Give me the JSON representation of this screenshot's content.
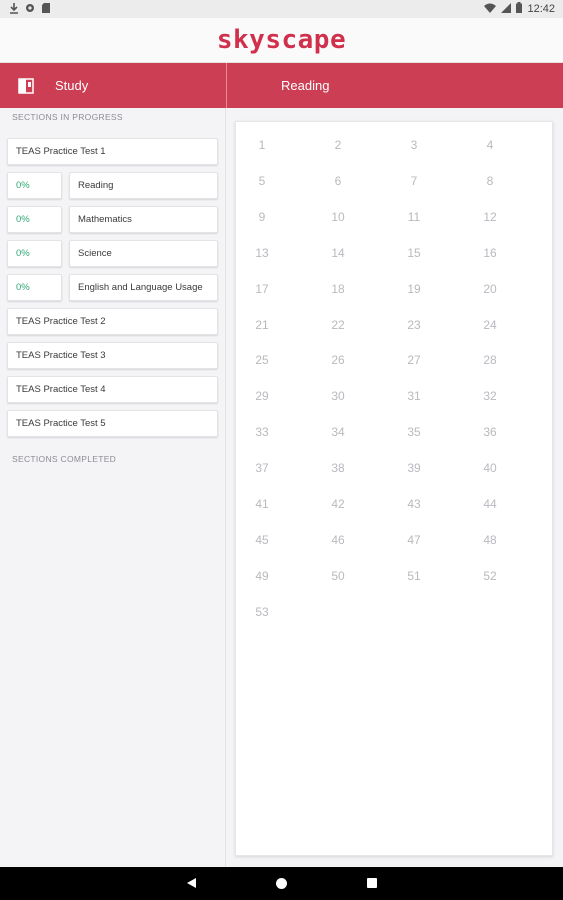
{
  "status_bar": {
    "time": "12:42",
    "left_icons": [
      "download-icon",
      "settings-sync-icon",
      "sd-card-icon"
    ],
    "right_icons": [
      "wifi-icon",
      "signal-icon",
      "battery-icon"
    ]
  },
  "app": {
    "logo_text": "skyscape"
  },
  "header": {
    "left_title": "Study",
    "right_title": "Reading",
    "accent_color": "#cc3e54"
  },
  "sidebar": {
    "in_progress_label": "SECTIONS IN PROGRESS",
    "completed_label": "SECTIONS COMPLETED",
    "tests": [
      "TEAS Practice Test 1",
      "TEAS Practice Test 2",
      "TEAS Practice Test 3",
      "TEAS Practice Test 4",
      "TEAS Practice Test 5"
    ],
    "sections": [
      {
        "percent": "0%",
        "name": "Reading"
      },
      {
        "percent": "0%",
        "name": "Mathematics"
      },
      {
        "percent": "0%",
        "name": "Science"
      },
      {
        "percent": "0%",
        "name": "English and Language Usage"
      }
    ]
  },
  "questions": [
    "1",
    "2",
    "3",
    "4",
    "5",
    "6",
    "7",
    "8",
    "9",
    "10",
    "11",
    "12",
    "13",
    "14",
    "15",
    "16",
    "17",
    "18",
    "19",
    "20",
    "21",
    "22",
    "23",
    "24",
    "25",
    "26",
    "27",
    "28",
    "29",
    "30",
    "31",
    "32",
    "33",
    "34",
    "35",
    "36",
    "37",
    "38",
    "39",
    "40",
    "41",
    "42",
    "43",
    "44",
    "45",
    "46",
    "47",
    "48",
    "49",
    "50",
    "51",
    "52",
    "53"
  ],
  "nav_bar": {
    "buttons": [
      "back-icon",
      "home-icon",
      "recents-icon"
    ]
  }
}
